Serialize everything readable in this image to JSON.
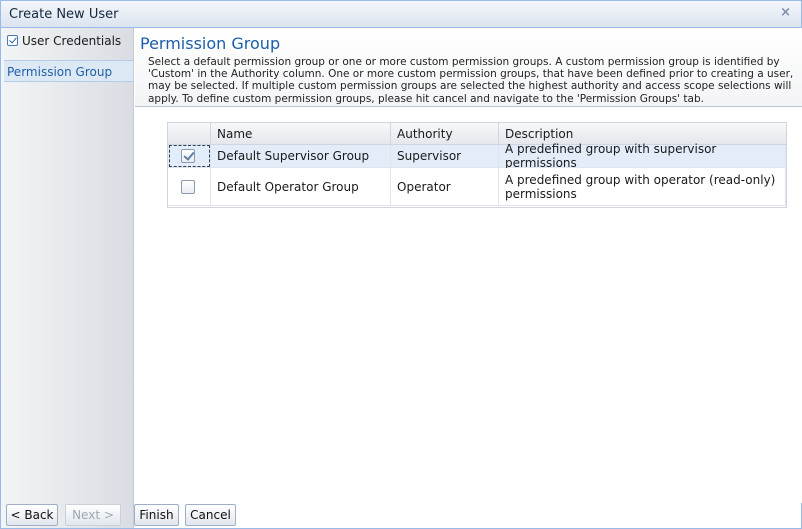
{
  "window": {
    "title": "Create New User",
    "close_glyph": "×"
  },
  "sidebar": {
    "items": [
      {
        "label": "User Credentials",
        "completed": true
      },
      {
        "label": "Permission Group",
        "active": true
      }
    ]
  },
  "main": {
    "heading": "Permission Group",
    "description": "Select a default permission group or one or more custom permission groups. A custom permission group is identified by 'Custom' in the Authority column. One or more custom permission groups, that have been defined prior to creating a user, may be selected. If multiple custom permission groups are selected the highest authority and access scope selections will apply. To define custom permission groups, please hit cancel and navigate to the 'Permission Groups' tab."
  },
  "grid": {
    "columns": [
      "Name",
      "Authority",
      "Description"
    ],
    "rows": [
      {
        "checked": true,
        "name": "Default Supervisor Group",
        "authority": "Supervisor",
        "description": "A predefined group with supervisor permissions"
      },
      {
        "checked": false,
        "name": "Default Operator Group",
        "authority": "Operator",
        "description": "A predefined group with operator (read-only) permissions"
      }
    ]
  },
  "footer": {
    "back_label": "< Back",
    "next_label": "Next >",
    "finish_label": "Finish",
    "cancel_label": "Cancel"
  },
  "colors": {
    "accent": "#1d5ea8",
    "selected_row": "#e3edf9",
    "border": "#99bbe8"
  },
  "icons": {
    "close": "close-icon",
    "check": "check-icon"
  }
}
